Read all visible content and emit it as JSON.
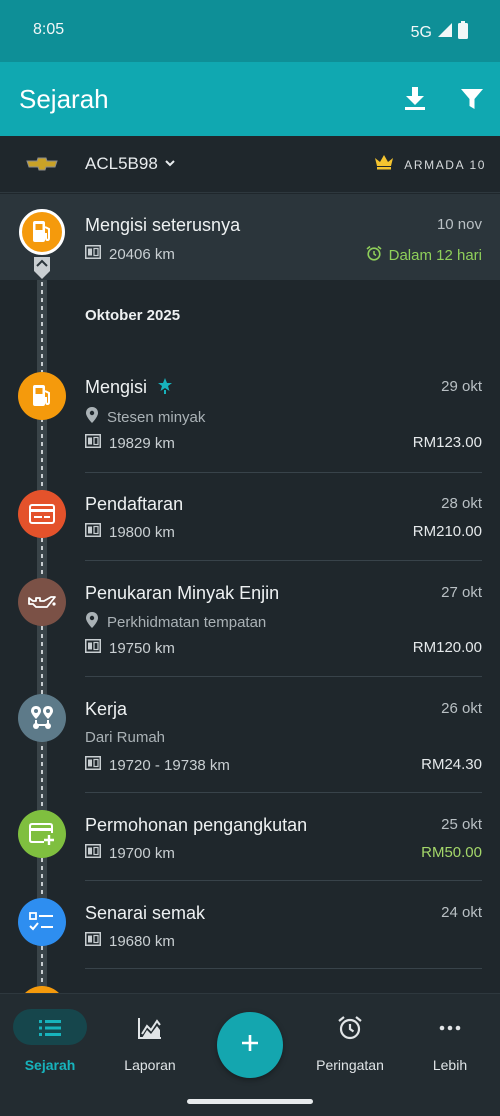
{
  "status_bar": {
    "time": "8:05",
    "network": "5G"
  },
  "app_bar": {
    "title": "Sejarah",
    "download_icon": "download-icon",
    "filter_icon": "filter-icon"
  },
  "vehicle": {
    "name": "ACL5B98",
    "fleet_label": "ARMADA 10",
    "logo_icon": "chevrolet-logo-icon",
    "crown_icon": "crown-icon"
  },
  "next_refuel": {
    "title": "Mengisi seterusnya",
    "date": "10 nov",
    "odometer": "20406 km",
    "reminder": "Dalam 12 hari",
    "icon": "fuel-pump-icon",
    "color": "#f59a0c"
  },
  "month_header": "Oktober 2025",
  "entries": [
    {
      "title": "Mengisi",
      "date": "29 okt",
      "location": "Stesen minyak",
      "odometer": "19829 km",
      "amount": "RM123.00",
      "icon": "fuel-pump-icon",
      "color": "#f59a0c",
      "badge_icon": "full-tank-icon"
    },
    {
      "title": "Pendaftaran",
      "date": "28 okt",
      "odometer": "19800 km",
      "amount": "RM210.00",
      "icon": "registration-card-icon",
      "color": "#e4522b"
    },
    {
      "title": "Penukaran Minyak Enjin",
      "date": "27 okt",
      "location": "Perkhidmatan tempatan",
      "odometer": "19750 km",
      "amount": "RM120.00",
      "icon": "oil-can-icon",
      "color": "#7b5146"
    },
    {
      "title": "Kerja",
      "date": "26 okt",
      "subtitle": "Dari Rumah",
      "odometer": "19720 - 19738 km",
      "amount": "RM24.30",
      "icon": "route-icon",
      "color": "#5d7a89"
    },
    {
      "title": "Permohonan pengangkutan",
      "date": "25 okt",
      "odometer": "19700 km",
      "amount": "RM50.00",
      "icon": "card-add-icon",
      "color": "#7fbf3f",
      "amount_color": "#a4d76a"
    },
    {
      "title": "Senarai semak",
      "date": "24 okt",
      "odometer": "19680 km",
      "icon": "checklist-icon",
      "color": "#2e8ef0"
    }
  ],
  "bottom_nav": {
    "items": [
      {
        "label": "Sejarah",
        "icon": "history-list-icon",
        "active": true
      },
      {
        "label": "Laporan",
        "icon": "chart-icon"
      },
      {
        "label": "Peringatan",
        "icon": "alarm-icon"
      },
      {
        "label": "Lebih",
        "icon": "more-icon"
      }
    ],
    "fab_icon": "add-icon"
  },
  "colors": {
    "accent": "#10a8b1",
    "reminder_green": "#8fcf5a"
  }
}
